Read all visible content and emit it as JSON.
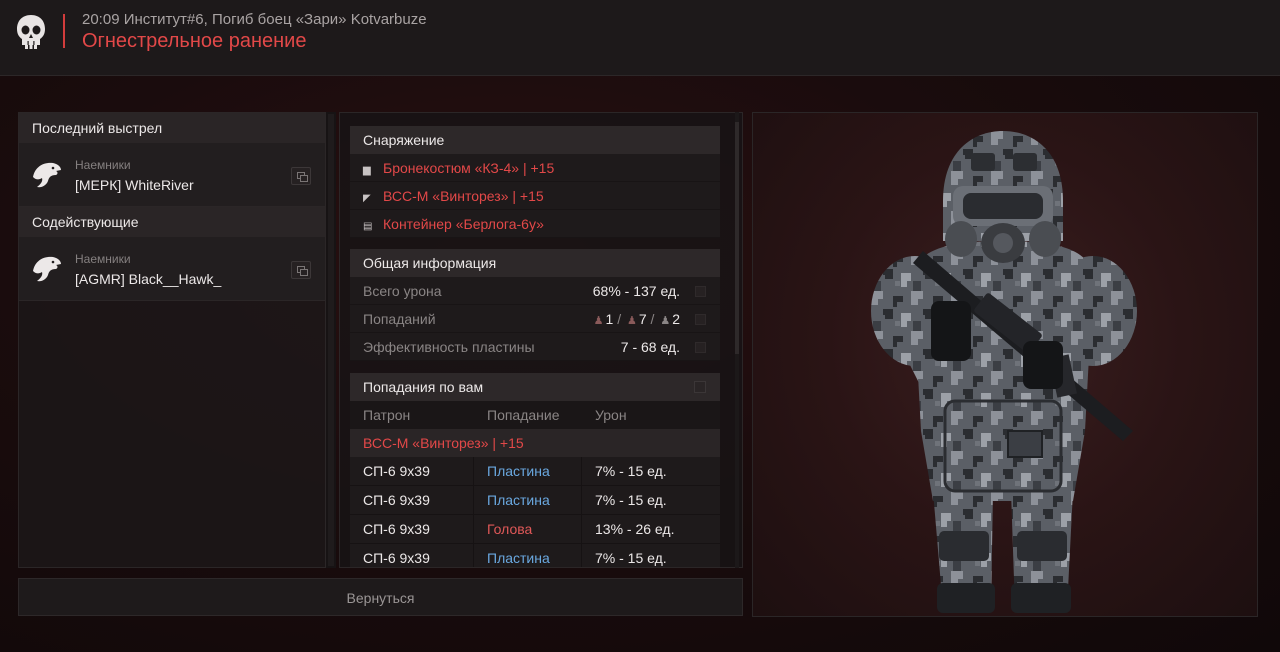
{
  "header": {
    "info_line": "20:09 Институт#6, Погиб боец «Зари» Kotvarbuze",
    "title": "Огнестрельное ранение"
  },
  "left": {
    "last_shot_label": "Последний выстрел",
    "last_shot": {
      "faction": "Наемники",
      "name": "[МЕРК] WhiteRiver"
    },
    "assists_label": "Содействующие",
    "assists": [
      {
        "faction": "Наемники",
        "name": "[AGMR] Black__Hawk_"
      }
    ]
  },
  "equipment": {
    "title": "Снаряжение",
    "items": [
      {
        "icon": "armor-icon",
        "label": "Бронекостюм «КЗ-4» | +15"
      },
      {
        "icon": "rifle-icon",
        "label": "ВСС-М «Винторез» | +15"
      },
      {
        "icon": "container-icon",
        "label": "Контейнер «Берлога-6у»"
      }
    ]
  },
  "general": {
    "title": "Общая информация",
    "rows": [
      {
        "label": "Всего урона",
        "value": "68% - 137 ед."
      },
      {
        "label": "Попаданий",
        "value": ""
      },
      {
        "label": "Эффективность пластины",
        "value": "7 - 68 ед."
      }
    ],
    "hits": [
      "1",
      "7",
      "2"
    ]
  },
  "hits_on_you": {
    "title": "Попадания по вам",
    "columns": [
      "Патрон",
      "Попадание",
      "Урон"
    ],
    "weapon": "ВСС-М «Винторез» | +15",
    "rows": [
      {
        "ammo": "СП-6 9х39",
        "hit": "Пластина",
        "damage": "7% - 15 ед."
      },
      {
        "ammo": "СП-6 9х39",
        "hit": "Пластина",
        "damage": "7% - 15 ед."
      },
      {
        "ammo": "СП-6 9х39",
        "hit": "Голова",
        "damage": "13% - 26 ед."
      },
      {
        "ammo": "СП-6 9х39",
        "hit": "Пластина",
        "damage": "7% - 15 ед."
      }
    ]
  },
  "footer": {
    "back_label": "Вернуться"
  },
  "colors": {
    "accent": "#e24848",
    "plate": "#6aa8e0",
    "head": "#e05858"
  }
}
